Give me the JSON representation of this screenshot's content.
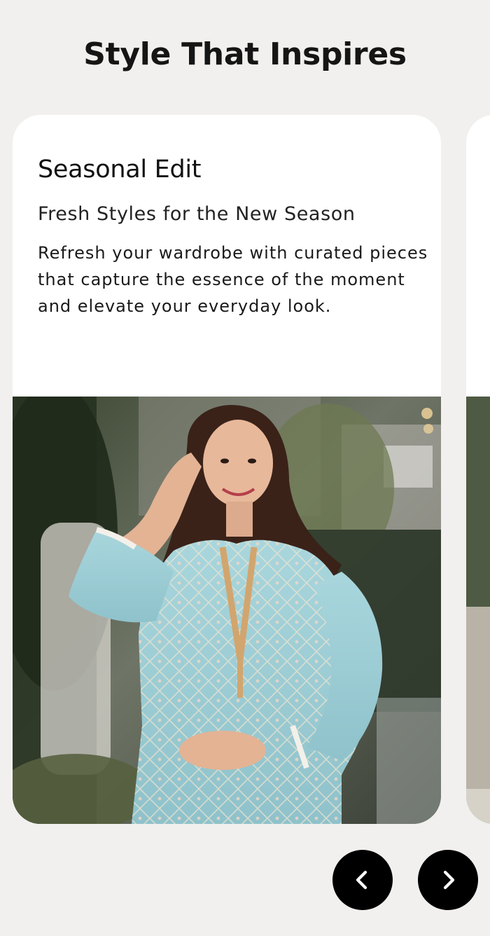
{
  "section": {
    "title": "Style That Inspires"
  },
  "cards": [
    {
      "title": "Seasonal Edit",
      "subtitle": "Fresh Styles for the New Season",
      "description": "Refresh your wardrobe with curated pieces that capture the essence of the moment and elevate your everyday look.",
      "image": "woman-in-light-blue-embroidered-kurta-photo"
    }
  ],
  "navigation": {
    "prev_icon": "chevron-left-icon",
    "next_icon": "chevron-right-icon"
  },
  "colors": {
    "page_background": "#f1f0ef",
    "card_background": "#ffffff",
    "button_background": "#000000",
    "button_icon": "#ffffff",
    "heading_text": "#151515"
  }
}
